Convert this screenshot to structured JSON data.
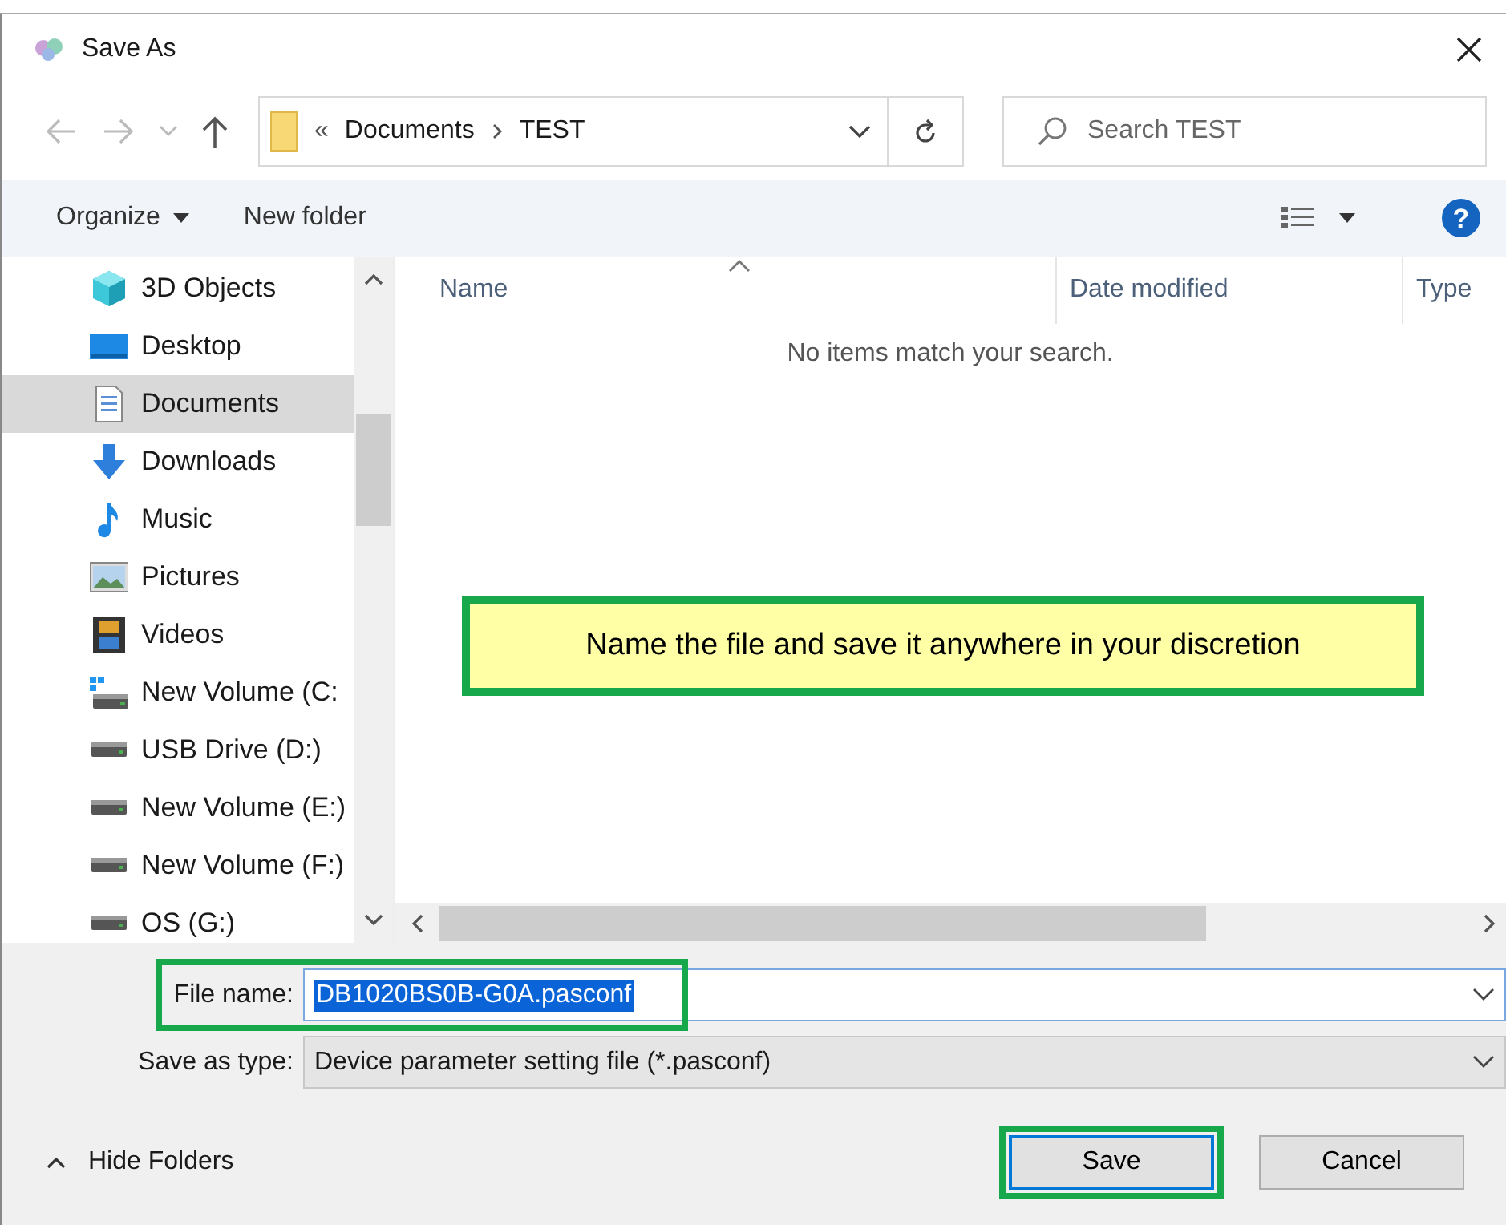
{
  "window": {
    "title": "Save As"
  },
  "address": {
    "overflow": "«",
    "path": [
      "Documents",
      "TEST"
    ]
  },
  "search": {
    "placeholder": "Search TEST"
  },
  "toolbar": {
    "organize": "Organize",
    "new_folder": "New folder",
    "help": "?"
  },
  "sidebar": {
    "items": [
      {
        "label": "3D Objects",
        "kind": "cube",
        "selected": false
      },
      {
        "label": "Desktop",
        "kind": "desktop",
        "selected": false
      },
      {
        "label": "Documents",
        "kind": "documents",
        "selected": true
      },
      {
        "label": "Downloads",
        "kind": "downloads",
        "selected": false
      },
      {
        "label": "Music",
        "kind": "music",
        "selected": false
      },
      {
        "label": "Pictures",
        "kind": "pictures",
        "selected": false
      },
      {
        "label": "Videos",
        "kind": "videos",
        "selected": false
      },
      {
        "label": "New Volume (C:",
        "kind": "system-drive",
        "selected": false
      },
      {
        "label": "USB Drive (D:)",
        "kind": "drive",
        "selected": false
      },
      {
        "label": "New Volume (E:)",
        "kind": "drive",
        "selected": false
      },
      {
        "label": "New Volume (F:)",
        "kind": "drive",
        "selected": false
      },
      {
        "label": "OS (G:)",
        "kind": "drive",
        "selected": false
      }
    ]
  },
  "columns": [
    "Name",
    "Date modified",
    "Type"
  ],
  "empty_message": "No items match your search.",
  "note": {
    "text": "Name the file and save it anywhere in your discretion"
  },
  "file_name": {
    "label": "File name:",
    "value": "DB1020BS0B-G0A.pasconf",
    "highlighted": true
  },
  "save_as_type": {
    "label": "Save as type:",
    "value": "Device parameter setting file (*.pasconf)"
  },
  "hide_folders": "Hide Folders",
  "buttons": [
    {
      "label": "Save",
      "kind": "primary",
      "highlighted": true
    },
    {
      "label": "Cancel",
      "kind": "secondary",
      "highlighted": false
    }
  ]
}
